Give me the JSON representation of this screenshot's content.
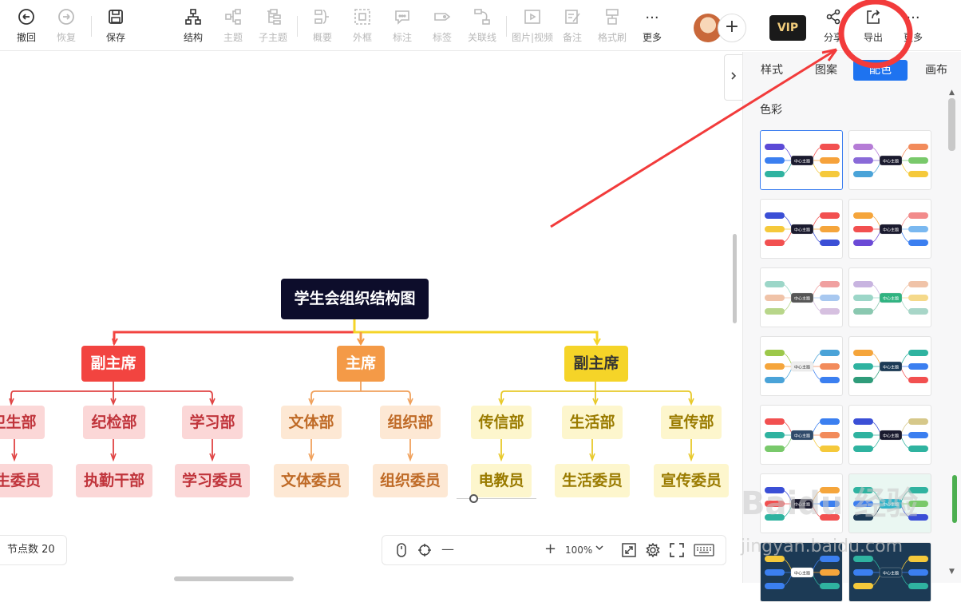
{
  "toolbar": {
    "undo": "撤回",
    "redo": "恢复",
    "save": "保存",
    "structure": "结构",
    "topic": "主题",
    "subtopic": "子主题",
    "summary": "概要",
    "frame": "外框",
    "note_mark": "标注",
    "tag": "标签",
    "relation": "关联线",
    "media": "图片|视频",
    "remark": "备注",
    "format_brush": "格式刷",
    "more": "更多",
    "vip": "VIP",
    "share": "分享",
    "export": "导出",
    "more2": "更多",
    "more_icon": "···",
    "add_icon": "+"
  },
  "mindmap": {
    "root": "学生会组织结构图",
    "branches": [
      {
        "label": "副主席",
        "children": [
          {
            "label": "卫生部",
            "leaf": "卫生委员"
          },
          {
            "label": "纪检部",
            "leaf": "执勤干部"
          },
          {
            "label": "学习部",
            "leaf": "学习委员"
          }
        ]
      },
      {
        "label": "主席",
        "children": [
          {
            "label": "文体部",
            "leaf": "文体委员"
          },
          {
            "label": "组织部",
            "leaf": "组织委员"
          }
        ]
      },
      {
        "label": "副主席",
        "children": [
          {
            "label": "传信部",
            "leaf": "电教员"
          },
          {
            "label": "生活部",
            "leaf": "生活委员"
          },
          {
            "label": "宣传部",
            "leaf": "宣传委员"
          }
        ]
      }
    ],
    "colors": {
      "red": "#f24440",
      "orange": "#f49a47",
      "yellow": "#f5d428",
      "root": "#0d0d2b"
    }
  },
  "status": {
    "node_count": "节点数 20",
    "zoom": "100%"
  },
  "panel": {
    "tabs": [
      "样式",
      "图案",
      "配色",
      "画布"
    ],
    "active_tab": "配色",
    "section_title": "色彩",
    "theme_center_label": "中心主题"
  },
  "watermark": {
    "main": "Baidu 经验",
    "sub": "jingyan.baidu.com"
  },
  "annotation_color": "#f23b3b"
}
